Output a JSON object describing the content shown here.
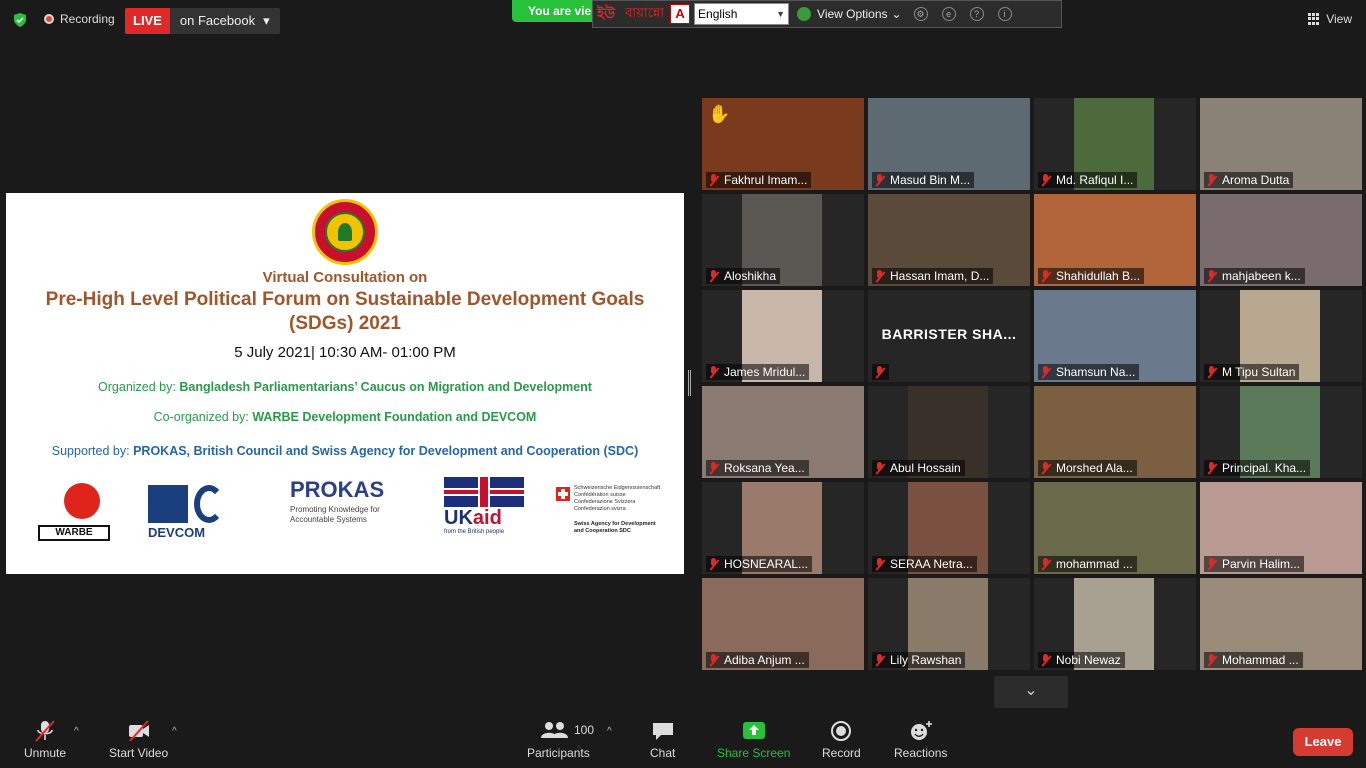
{
  "topbar": {
    "recording_label": "Recording",
    "live_label": "LIVE",
    "live_platform": "on Facebook",
    "viewing_banner": "You are vie",
    "ime_name": "বায়ান্নো",
    "ime_logo": "ইউ",
    "language_value": "English",
    "view_options_label": "View Options",
    "view_label": "View"
  },
  "slide": {
    "heading": "Virtual Consultation on",
    "title": "Pre-High Level Political Forum on Sustainable Development Goals (SDGs) 2021",
    "date": "5 July 2021| 10:30 AM- 01:00 PM",
    "organized_label": "Organized by:",
    "organized_value": "Bangladesh Parliamentarians’ Caucus on Migration and Development",
    "coorganized_label": "Co-organized by:",
    "coorganized_value": "WARBE Development Foundation and DEVCOM",
    "supported_label": "Supported by:",
    "supported_value": "PROKAS, British Council and Swiss Agency for Development and Cooperation (SDC)",
    "logos": {
      "warbe": "WARBE",
      "devcom": "DEVCOM",
      "prokas": "PROKAS",
      "prokas_tagline": "Promoting Knowledge for Accountable Systems",
      "ukaid": "UK",
      "ukaid_red": "aid",
      "ukaid_sub": "from the British people",
      "swiss_lines": "Schweizerische Eidgenossenschaft Confédération suisse Confederazione Svizzera Confederaziun svizra",
      "swiss_agency": "Swiss Agency for Development and Cooperation SDC"
    }
  },
  "participants": [
    {
      "name": "Fakhrul Imam...",
      "video": "#7a3a1e",
      "hand": true
    },
    {
      "name": "Masud Bin M...",
      "video": "#5e6a72",
      "hand": false
    },
    {
      "name": "Md. Rafiqul I...",
      "video": "#4d6a3c",
      "hand": false
    },
    {
      "name": "Aroma Dutta",
      "video": "#8a8275",
      "hand": false
    },
    {
      "name": "Aloshikha",
      "video": "#5a5752",
      "hand": false
    },
    {
      "name": "Hassan Imam, D...",
      "video": "#5a4a3a",
      "hand": false,
      "active": true
    },
    {
      "name": "Shahidullah B...",
      "video": "#b2643a",
      "hand": false
    },
    {
      "name": "mahjabeen k...",
      "video": "#7a6c6c",
      "hand": false
    },
    {
      "name": "James Mridul...",
      "video": "#c8b6a8",
      "hand": false
    },
    {
      "name": "",
      "video": "",
      "hand": false,
      "big": "BARRISTER SHA..."
    },
    {
      "name": "Shamsun Na...",
      "video": "#6a7a8c",
      "hand": false
    },
    {
      "name": "M Tipu Sultan",
      "video": "#b8a890",
      "hand": false
    },
    {
      "name": "Roksana Yea...",
      "video": "#8a7a72",
      "hand": false
    },
    {
      "name": "Abul Hossain",
      "video": "#3a302a",
      "hand": false
    },
    {
      "name": "Morshed Ala...",
      "video": "#7a6040",
      "hand": false
    },
    {
      "name": "Principal. Kha...",
      "video": "#5a7a5a",
      "hand": false
    },
    {
      "name": "HOSNEARAL...",
      "video": "#9a7a6a",
      "hand": false
    },
    {
      "name": "SERAA Netra...",
      "video": "#7a5040",
      "hand": false
    },
    {
      "name": "mohammad ...",
      "video": "#6a6a4a",
      "hand": false
    },
    {
      "name": "Parvin Halim...",
      "video": "#b89a92",
      "hand": false
    },
    {
      "name": "Adiba Anjum ...",
      "video": "#8a6a5a",
      "hand": false
    },
    {
      "name": "Lily Rawshan",
      "video": "#8a7a6a",
      "hand": false
    },
    {
      "name": "Nobi Newaz",
      "video": "#a8a090",
      "hand": false
    },
    {
      "name": "Mohammad ...",
      "video": "#9a8a7a",
      "hand": false
    }
  ],
  "toolbar": {
    "unmute": "Unmute",
    "start_video": "Start Video",
    "participants": "Participants",
    "participants_count": "100",
    "chat": "Chat",
    "share_screen": "Share Screen",
    "record": "Record",
    "reactions": "Reactions",
    "leave": "Leave"
  },
  "colors": {
    "live": "#e02828",
    "share_green": "#27c13a",
    "leave_red": "#d53b30",
    "active_speaker": "#e8e26a"
  }
}
